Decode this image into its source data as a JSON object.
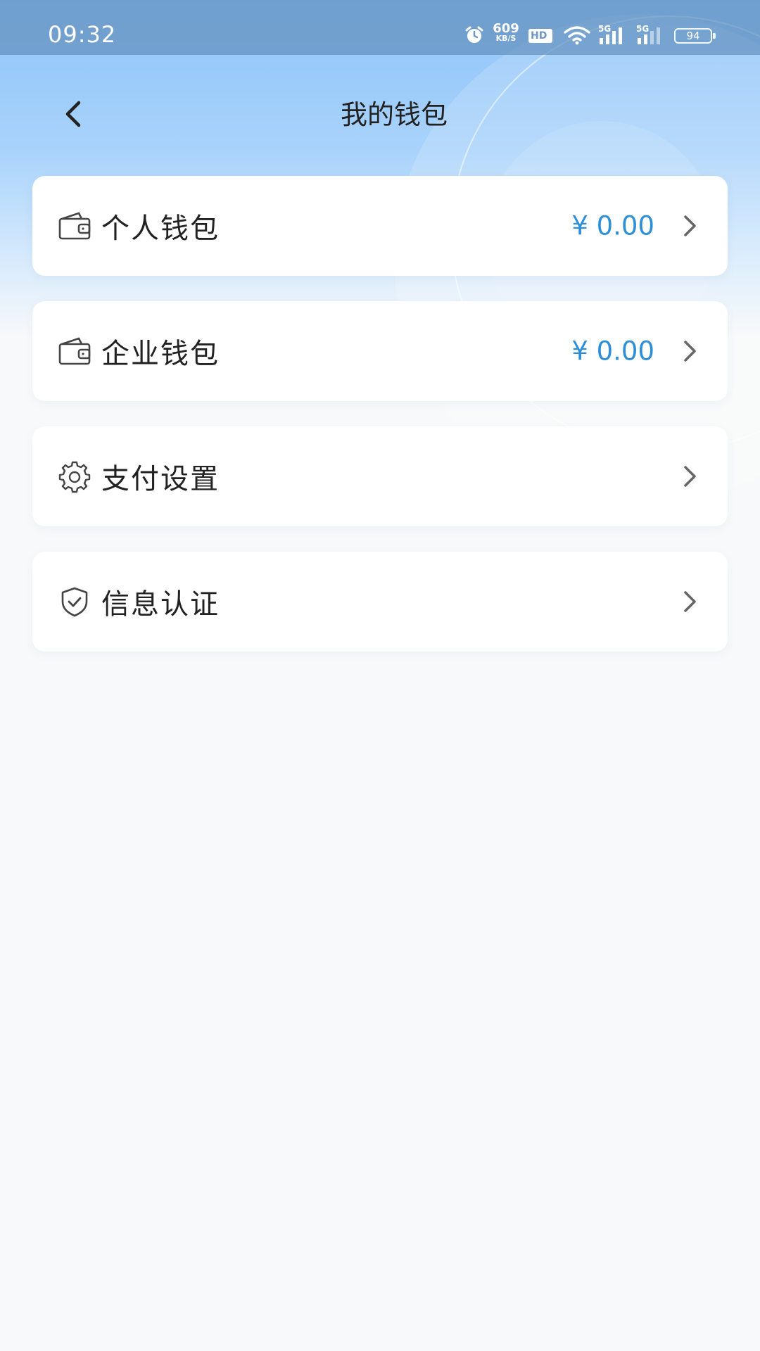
{
  "status_bar": {
    "time": "09:32",
    "net_speed_value": "609",
    "net_speed_unit": "KB/S",
    "hd_label": "HD",
    "signal_1_label": "5G",
    "signal_2_label": "5G",
    "battery_level": "94",
    "icons": [
      "alarm-icon",
      "hd-icon",
      "wifi-icon",
      "signal-icon",
      "signal-icon",
      "battery-icon"
    ]
  },
  "nav": {
    "title": "我的钱包",
    "back_icon": "chevron-left-icon"
  },
  "menu": [
    {
      "id": "personal-wallet",
      "label": "个人钱包",
      "amount": "¥ 0.00",
      "icon": "wallet-icon"
    },
    {
      "id": "enterprise-wallet",
      "label": "企业钱包",
      "amount": "¥ 0.00",
      "icon": "wallet-icon"
    },
    {
      "id": "payment-settings",
      "label": "支付设置",
      "amount": "",
      "icon": "gear-icon"
    },
    {
      "id": "info-verification",
      "label": "信息认证",
      "amount": "",
      "icon": "shield-check-icon"
    }
  ],
  "colors": {
    "accent_amount": "#2e8fd9",
    "header_blue": "#8ec3f9",
    "page_bg": "#f8f9fa",
    "text_primary": "#222222",
    "chevron": "#666666"
  }
}
